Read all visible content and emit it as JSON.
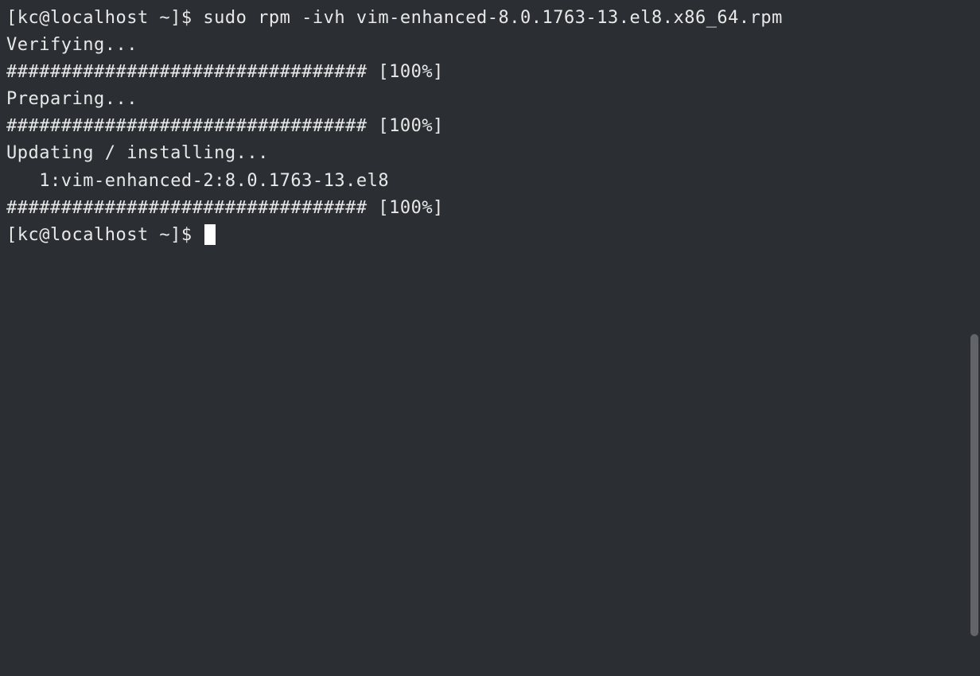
{
  "lines": {
    "l1": "[kc@localhost ~]$ sudo rpm -ivh vim-enhanced-8.0.1763-13.el8.x86_64.rpm",
    "l2": "Verifying...",
    "l3": "################################# [100%]",
    "l4": "Preparing...",
    "l5": "################################# [100%]",
    "l6": "Updating / installing...",
    "l7": "   1:vim-enhanced-2:8.0.1763-13.el8",
    "l8": "################################# [100%]",
    "l9": "[kc@localhost ~]$ "
  }
}
